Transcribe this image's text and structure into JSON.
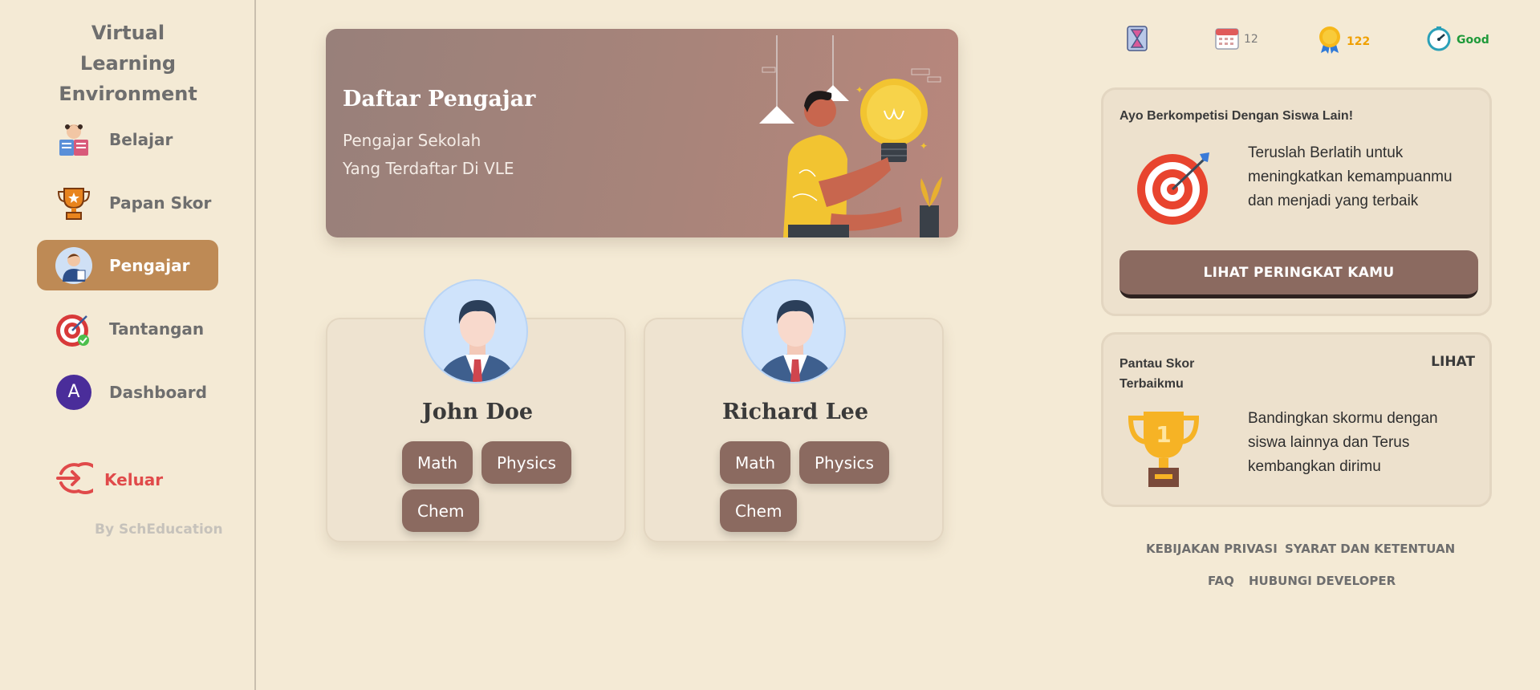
{
  "sidebar": {
    "brand": "Virtual Learning Environment",
    "items": [
      {
        "label": "Belajar",
        "icon": "reading-icon",
        "active": false
      },
      {
        "label": "Papan Skor",
        "icon": "trophy-icon",
        "active": false
      },
      {
        "label": "Pengajar",
        "icon": "teacher-icon",
        "active": true
      },
      {
        "label": "Tantangan",
        "icon": "target-icon",
        "active": false
      },
      {
        "label": "Dashboard",
        "icon": "avatar-icon",
        "active": false
      }
    ],
    "avatar_letter": "A",
    "logout_label": "Keluar",
    "byline": "By SchEducation"
  },
  "hero": {
    "title": "Daftar Pengajar",
    "subtitle_line1": "Pengajar Sekolah",
    "subtitle_line2": "Yang Terdaftar Di VLE"
  },
  "teachers": [
    {
      "name": "John Doe",
      "subjects": [
        "Math",
        "Physics",
        "Chem"
      ]
    },
    {
      "name": "Richard Lee",
      "subjects": [
        "Math",
        "Physics",
        "Chem"
      ]
    }
  ],
  "stats": {
    "hourglass_icon": "hourglass-icon",
    "calendar_value": "12",
    "points_value": "122",
    "status_value": "Good",
    "colors": {
      "calendar": "#7a7a7a",
      "points": "#f0a000",
      "status": "#1f9a3a"
    }
  },
  "compete_panel": {
    "title": "Ayo Berkompetisi Dengan Siswa Lain!",
    "text": "Teruslah Berlatih untuk meningkatkan kemampuanmu dan menjadi yang terbaik",
    "button_label": "LIHAT PERINGKAT KAMU"
  },
  "score_panel": {
    "title": "Pantau Skor Terbaikmu",
    "link_label": "LIHAT",
    "text": "Bandingkan skormu dengan siswa lainnya dan Terus kembangkan dirimu"
  },
  "footer": {
    "privacy": "KEBIJAKAN PRIVASI",
    "terms": "SYARAT DAN KETENTUAN",
    "faq": "FAQ",
    "contact": "HUBUNGI DEVELOPER"
  },
  "colors": {
    "background": "#f4ead5",
    "active_nav": "#be8a55",
    "primary_button": "#8b6a60",
    "logout": "#e04a4a"
  }
}
